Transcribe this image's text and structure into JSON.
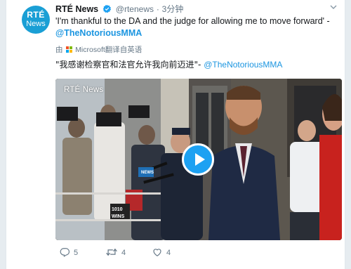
{
  "tweet": {
    "avatar": {
      "line1": "RTÉ",
      "line2": "News",
      "color": "#1a9fd5"
    },
    "display_name": "RTÉ News",
    "handle": "@rtenews",
    "separator": "·",
    "time": "3分钟",
    "text_quote": "'I'm thankful to the DA and the judge for allowing me to move forward' -",
    "text_mention": "@TheNotoriousMMA",
    "translation_prefix": "由",
    "translation_brand": "Microsoft",
    "translation_suffix": "翻译自英语",
    "translated_text": "\"我感谢检察官和法官允许我向前迈进\"-",
    "translated_mention": "@TheNotoriousMMA",
    "media": {
      "overlay_logo": "RTÉ News",
      "sign_text_1": "1010",
      "sign_text_2": "WINS",
      "mic_text": "NEWS"
    },
    "actions": {
      "reply_icon": "reply-icon",
      "reply_count": "5",
      "retweet_icon": "retweet-icon",
      "retweet_count": "4",
      "like_icon": "heart-icon",
      "like_count": "4"
    },
    "colors": {
      "link": "#1b95e0",
      "play": "#1da1f2",
      "verified": "#1da1f2"
    }
  }
}
